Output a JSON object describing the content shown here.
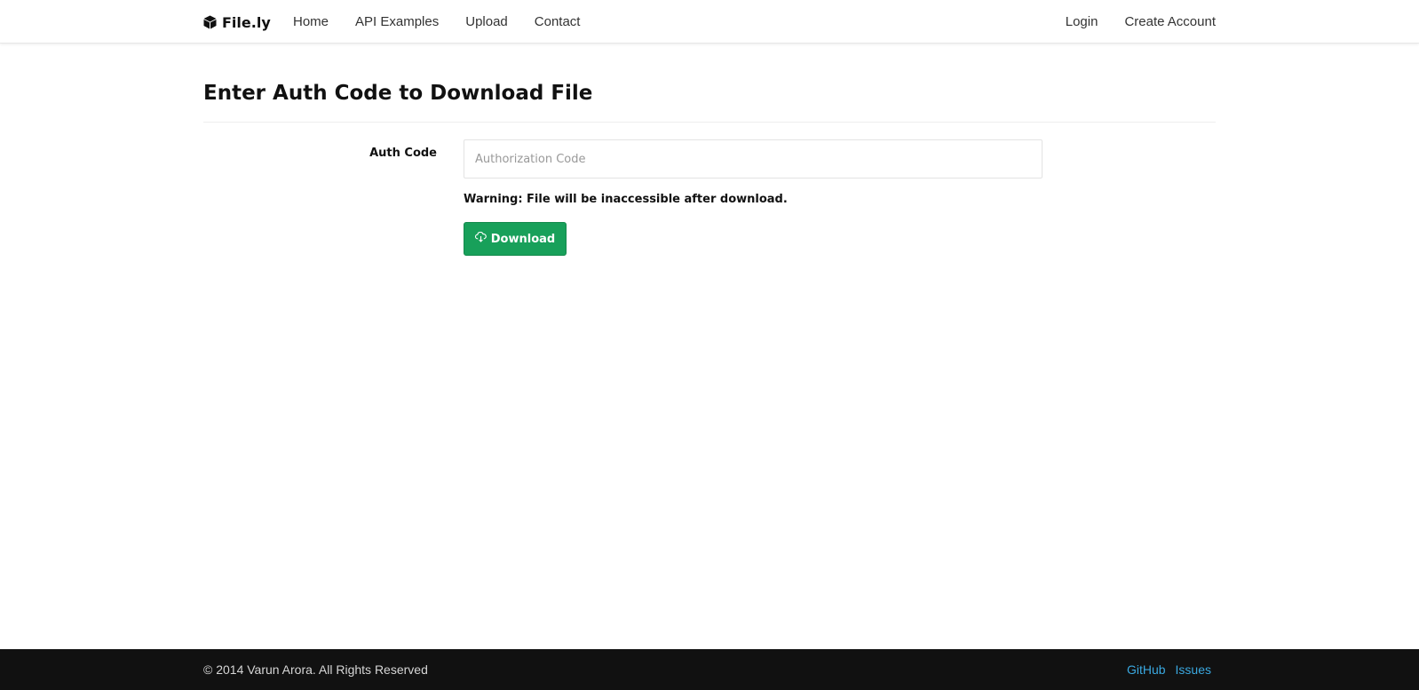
{
  "navbar": {
    "brand": "File.ly",
    "brand_icon": "cube-icon",
    "links": [
      "Home",
      "API Examples",
      "Upload",
      "Contact"
    ],
    "right_links": [
      "Login",
      "Create Account"
    ]
  },
  "main": {
    "title": "Enter Auth Code to Download File",
    "auth_label": "Auth Code",
    "auth_placeholder": "Authorization Code",
    "auth_value": "",
    "warning": "Warning: File will be inaccessible after download.",
    "download_label": "Download",
    "download_icon": "cloud-download-icon"
  },
  "footer": {
    "copyright": "© 2014 Varun Arora. All Rights Reserved",
    "links": [
      "GitHub",
      "Issues"
    ]
  },
  "colors": {
    "accent": "#18a05a",
    "footer_bg": "#111111",
    "footer_link": "#3aa8e0"
  }
}
